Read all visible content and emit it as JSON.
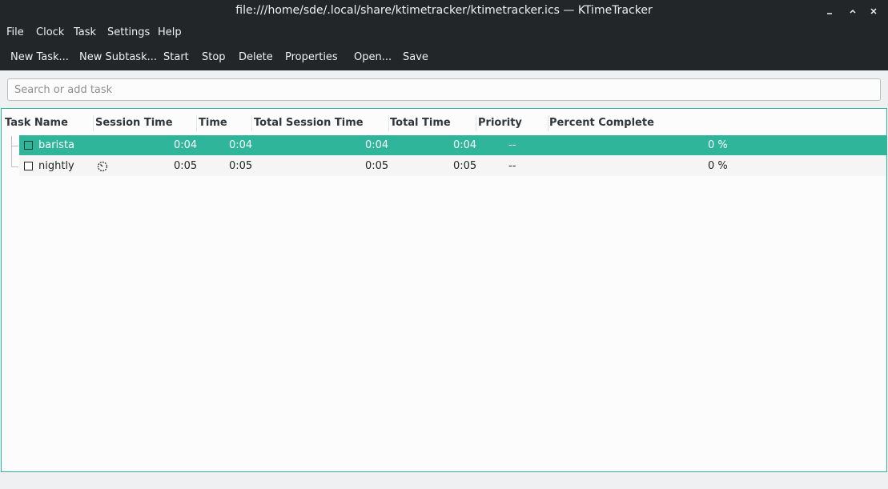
{
  "window": {
    "title": "file:///home/sde/.local/share/ktimetracker/ktimetracker.ics — KTimeTracker",
    "minimize_icon": "minimize-icon",
    "restore_icon": "restore-icon",
    "close_icon": "close-icon"
  },
  "menu": [
    "File",
    "Clock",
    "Task",
    "Settings",
    "Help"
  ],
  "toolbar": {
    "new_task": "New Task...",
    "new_subtask": "New Subtask...",
    "start": "Start",
    "stop": "Stop",
    "delete": "Delete",
    "properties": "Properties",
    "open": "Open...",
    "save": "Save"
  },
  "search": {
    "placeholder": "Search or add task"
  },
  "columns": [
    "Task Name",
    "Session Time",
    "Time",
    "Total Session Time",
    "Total Time",
    "Priority",
    "Percent Complete"
  ],
  "tasks": [
    {
      "name": "barista",
      "session_time": "0:04",
      "time": "0:04",
      "total_session_time": "0:04",
      "total_time": "0:04",
      "priority": "--",
      "percent_complete": "0 %",
      "selected": true,
      "running_icon": ""
    },
    {
      "name": "nightly",
      "session_time": "0:05",
      "time": "0:05",
      "total_session_time": "0:05",
      "total_time": "0:05",
      "priority": "--",
      "percent_complete": "0 %",
      "selected": false,
      "running_icon": "clock-icon"
    }
  ],
  "colors": {
    "accent": "#2fb59a",
    "titlebar": "#232629"
  }
}
